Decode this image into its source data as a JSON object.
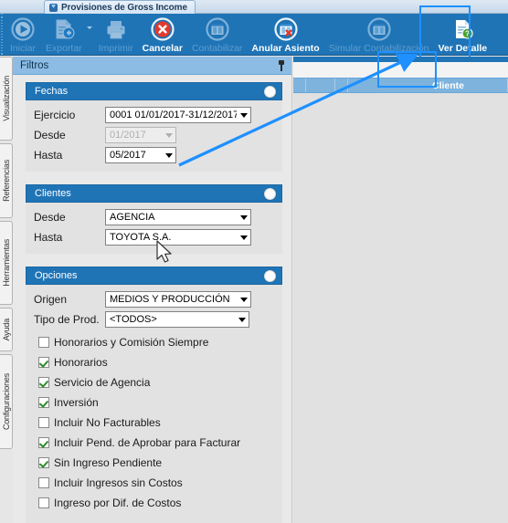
{
  "window": {
    "tab_title": "Provisiones de Gross Income",
    "tab_icon": "app-icon"
  },
  "toolbar": {
    "buttons": [
      {
        "label": "Iniciar",
        "icon": "play-icon",
        "enabled": false,
        "bold": false
      },
      {
        "label": "Exportar",
        "icon": "export-icon",
        "enabled": false,
        "bold": false
      },
      {
        "label": "Imprimir",
        "icon": "printer-icon",
        "enabled": false,
        "bold": false
      },
      {
        "label": "Cancelar",
        "icon": "cancel-x-icon",
        "enabled": true,
        "bold": true
      },
      {
        "label": "Contabilizar",
        "icon": "ledger-icon",
        "enabled": false,
        "bold": false
      },
      {
        "label": "Anular Asiento",
        "icon": "ledger-cancel-icon",
        "enabled": true,
        "bold": true
      },
      {
        "label": "Simular Contabilización",
        "icon": "ledger-icon",
        "enabled": false,
        "bold": false
      },
      {
        "label": "Ver Detalle",
        "icon": "document-help-icon",
        "enabled": true,
        "bold": true
      }
    ]
  },
  "sidebar": {
    "tabs": [
      {
        "label": "Visualización"
      },
      {
        "label": "Referencias"
      },
      {
        "label": "Herramientas"
      },
      {
        "label": "Ayuda"
      },
      {
        "label": "Configuraciones"
      }
    ]
  },
  "filters": {
    "title": "Filtros",
    "pin_icon": "pin-icon",
    "groups": [
      {
        "title": "Fechas",
        "toggle_icon": "toggle-knob",
        "fields": [
          {
            "label": "Ejercicio",
            "value": "0001 01/01/2017-31/12/2017",
            "enabled": true
          },
          {
            "label": "Desde",
            "value": "01/2017",
            "enabled": false
          },
          {
            "label": "Hasta",
            "value": "05/2017",
            "enabled": true
          }
        ]
      },
      {
        "title": "Clientes",
        "toggle_icon": "toggle-knob",
        "fields": [
          {
            "label": "Desde",
            "value": "AGENCIA",
            "enabled": true
          },
          {
            "label": "Hasta",
            "value": "TOYOTA S.A.",
            "enabled": true
          }
        ]
      },
      {
        "title": "Opciones",
        "toggle_icon": "toggle-knob",
        "fields": [
          {
            "label": "Origen",
            "value": "MEDIOS Y PRODUCCIÓN",
            "enabled": true
          },
          {
            "label": "Tipo de Prod.",
            "value": "<TODOS>",
            "enabled": true
          }
        ],
        "checkboxes": [
          {
            "label": "Honorarios y Comisión Siempre",
            "checked": false
          },
          {
            "label": "Honorarios",
            "checked": true
          },
          {
            "label": "Servicio de Agencia",
            "checked": true
          },
          {
            "label": "Inversión",
            "checked": true
          },
          {
            "label": "Incluir No Facturables",
            "checked": false
          },
          {
            "label": "Incluir Pend. de Aprobar para Facturar",
            "checked": true
          },
          {
            "label": "Sin Ingreso Pendiente",
            "checked": true
          },
          {
            "label": "Incluir Ingresos sin Costos",
            "checked": false
          },
          {
            "label": "Ingreso por Dif. de Costos",
            "checked": false
          }
        ]
      }
    ]
  },
  "grid": {
    "column_header": "Cliente"
  },
  "annotation": {
    "highlight_color": "#1e90ff",
    "arrow_target": "ver-detalle-button"
  },
  "colors": {
    "ribbon_blue": "#1f74b6",
    "panel_header_blue": "#1f74b6",
    "filters_header_blue": "#8cbce4",
    "grid_header_blue": "#7eb3de",
    "check_green": "#2d8a2d",
    "cancel_red": "#e03a2f"
  }
}
